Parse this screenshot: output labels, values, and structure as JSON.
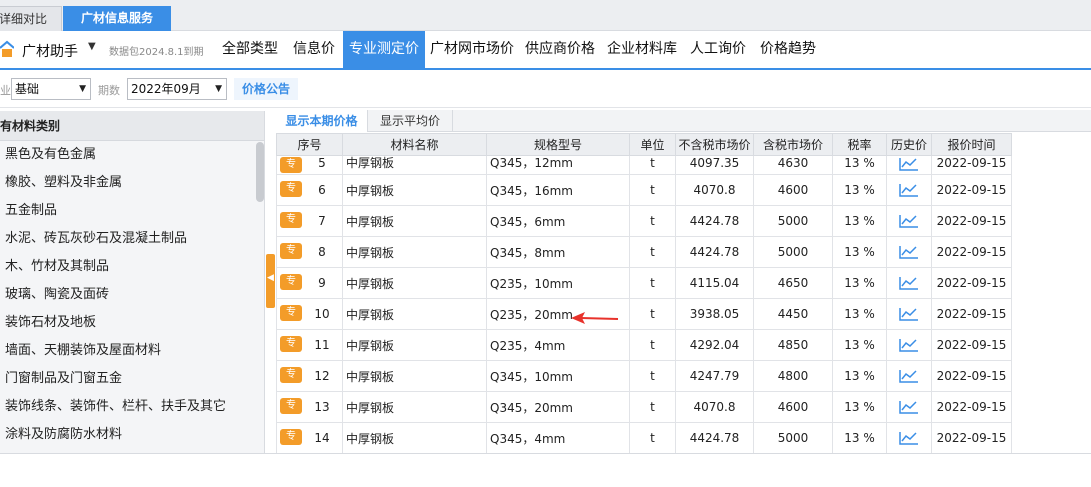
{
  "top_tabs": [
    "详细对比",
    "广材信息服务"
  ],
  "nav": {
    "brand": "广材助手",
    "datapack": "数据包2024.8.1到期",
    "items": [
      "全部类型",
      "信息价",
      "专业测定价",
      "广材网市场价",
      "供应商价格",
      "企业材料库",
      "人工询价",
      "价格趋势"
    ],
    "active": "专业测定价"
  },
  "filters": {
    "trade_label": "业",
    "trade_value": "基础",
    "period_label": "期数",
    "period_value": "2022年09月",
    "notice_button": "价格公告"
  },
  "left_panel": {
    "header": "有材料类别",
    "categories": [
      "黑色及有色金属",
      "橡胶、塑料及非金属",
      "五金制品",
      "水泥、砖瓦灰砂石及混凝土制品",
      "木、竹材及其制品",
      "玻璃、陶瓷及面砖",
      "装饰石材及地板",
      "墙面、天棚装饰及屋面材料",
      "门窗制品及门窗五金",
      "装饰线条、装饰件、栏杆、扶手及其它",
      "涂料及防腐防水材料"
    ]
  },
  "sub_tabs": [
    "显示本期价格",
    "显示平均价"
  ],
  "table": {
    "headers": [
      "序号",
      "材料名称",
      "规格型号",
      "单位",
      "不含税市场价",
      "含税市场价",
      "税率",
      "历史价",
      "报价时间"
    ],
    "badge": "专",
    "rows": [
      {
        "no": "5",
        "name": "中厚钢板",
        "spec": "Q345，12mm",
        "unit": "t",
        "price_ex": "4097.35",
        "price_in": "4630",
        "tax": "13 %",
        "date": "2022-09-15"
      },
      {
        "no": "6",
        "name": "中厚钢板",
        "spec": "Q345，16mm",
        "unit": "t",
        "price_ex": "4070.8",
        "price_in": "4600",
        "tax": "13 %",
        "date": "2022-09-15"
      },
      {
        "no": "7",
        "name": "中厚钢板",
        "spec": "Q345，6mm",
        "unit": "t",
        "price_ex": "4424.78",
        "price_in": "5000",
        "tax": "13 %",
        "date": "2022-09-15"
      },
      {
        "no": "8",
        "name": "中厚钢板",
        "spec": "Q345，8mm",
        "unit": "t",
        "price_ex": "4424.78",
        "price_in": "5000",
        "tax": "13 %",
        "date": "2022-09-15"
      },
      {
        "no": "9",
        "name": "中厚钢板",
        "spec": "Q235，10mm",
        "unit": "t",
        "price_ex": "4115.04",
        "price_in": "4650",
        "tax": "13 %",
        "date": "2022-09-15"
      },
      {
        "no": "10",
        "name": "中厚钢板",
        "spec": "Q235，20mm",
        "unit": "t",
        "price_ex": "3938.05",
        "price_in": "4450",
        "tax": "13 %",
        "date": "2022-09-15"
      },
      {
        "no": "11",
        "name": "中厚钢板",
        "spec": "Q235，4mm",
        "unit": "t",
        "price_ex": "4292.04",
        "price_in": "4850",
        "tax": "13 %",
        "date": "2022-09-15"
      },
      {
        "no": "12",
        "name": "中厚钢板",
        "spec": "Q345，10mm",
        "unit": "t",
        "price_ex": "4247.79",
        "price_in": "4800",
        "tax": "13 %",
        "date": "2022-09-15"
      },
      {
        "no": "13",
        "name": "中厚钢板",
        "spec": "Q345，20mm",
        "unit": "t",
        "price_ex": "4070.8",
        "price_in": "4600",
        "tax": "13 %",
        "date": "2022-09-15"
      },
      {
        "no": "14",
        "name": "中厚钢板",
        "spec": "Q345，4mm",
        "unit": "t",
        "price_ex": "4424.78",
        "price_in": "5000",
        "tax": "13 %",
        "date": "2022-09-15"
      }
    ]
  },
  "icons": [
    "home-icon",
    "dropdown-caret-icon",
    "trend-chart-icon",
    "collapse-arrow-icon",
    "red-arrow-icon"
  ],
  "colors": {
    "accent": "#3a8ee6",
    "badge": "#f39c29",
    "annotation": "#e8322b"
  }
}
